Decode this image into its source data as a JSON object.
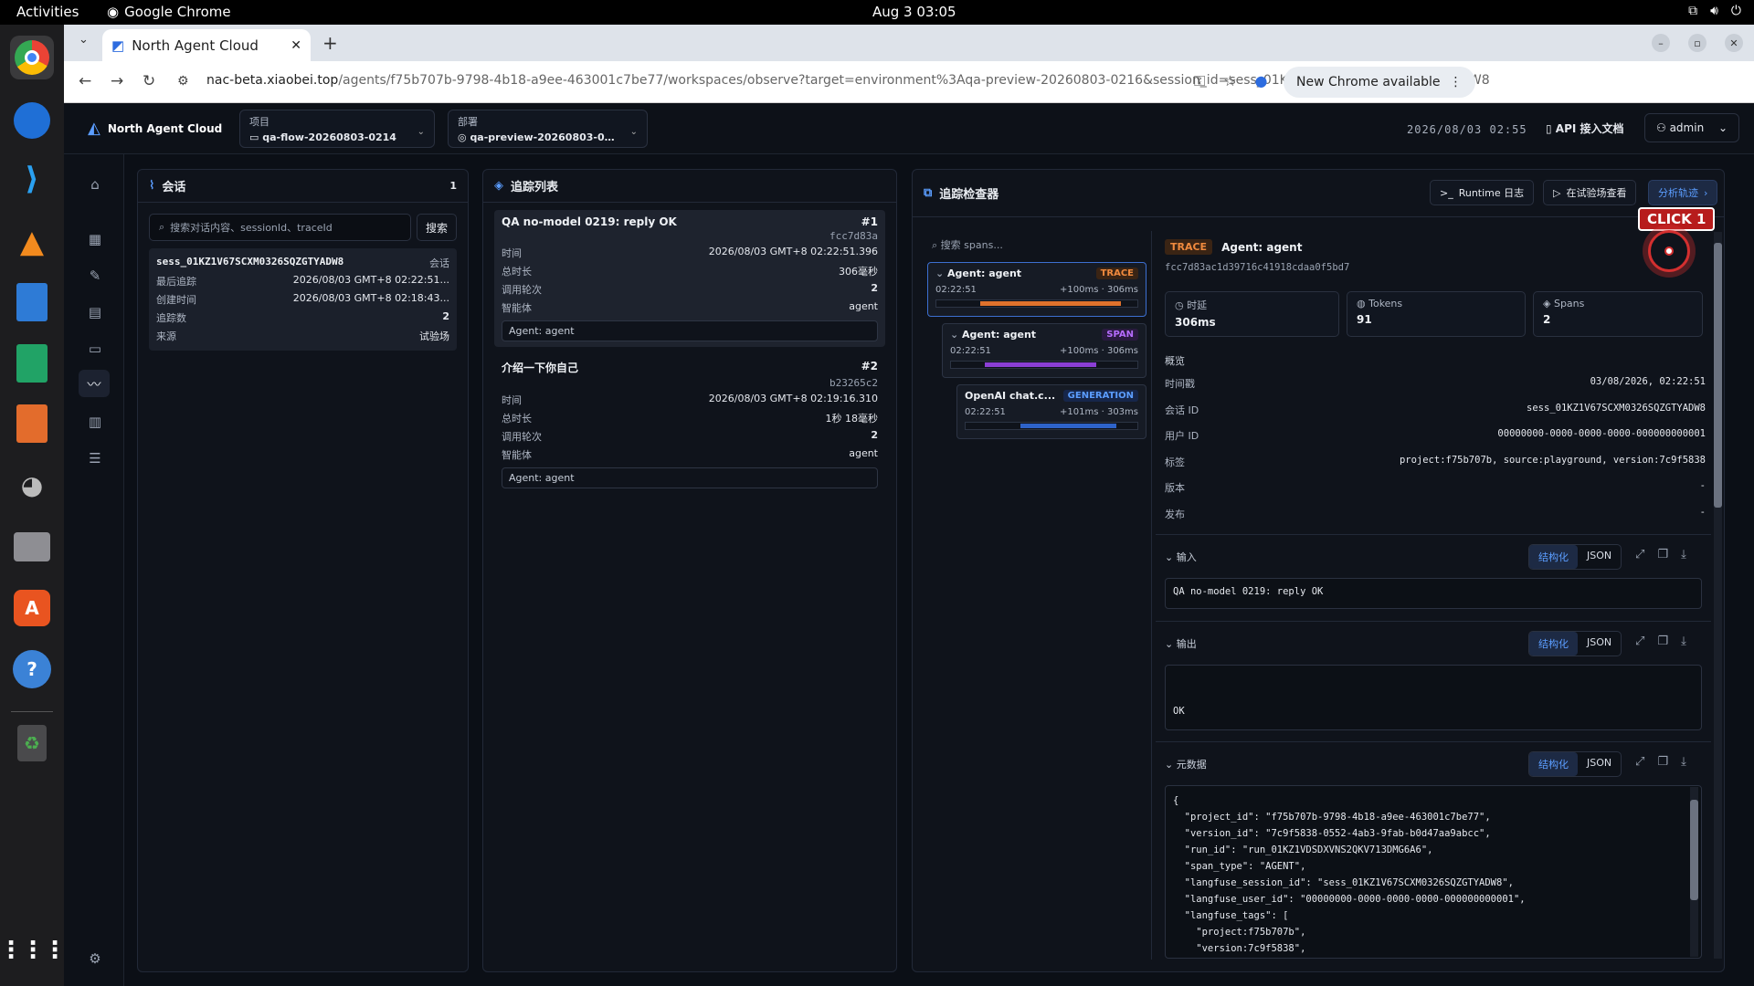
{
  "gnome": {
    "activities": "Activities",
    "app": "Google Chrome",
    "clock": "Aug 3  03:05"
  },
  "chrome": {
    "tab_title": "North Agent Cloud",
    "url_host": "nac-beta.xiaobei.top",
    "url_path": "/agents/f75b707b-9798-4b18-a9ee-463001c7be77/workspaces/observe?target=environment%3Aqa-preview-20260803-0216&session_id=sess_01KZ1V67SCXM0326SQZGTYADW8",
    "update_label": "New Chrome available"
  },
  "header": {
    "brand": "North Agent Cloud",
    "project_label": "项目",
    "project_value": "qa-flow-20260803-0214",
    "deploy_label": "部署",
    "deploy_value": "qa-preview-20260803-0…",
    "timestamp": "2026/08/03 02:55",
    "api_doc": "API 接入文档",
    "user": "admin"
  },
  "sessions": {
    "title": "会话",
    "count": "1",
    "search_placeholder": "搜索对话内容、sessionId、traceId",
    "search_btn": "搜索",
    "item": {
      "id": "sess_01KZ1V67SCXM0326SQZGTYADW8",
      "tag": "会话",
      "rows": [
        {
          "k": "最后追踪",
          "v": "2026/08/03 GMT+8 02:22:51..."
        },
        {
          "k": "创建时间",
          "v": "2026/08/03 GMT+8 02:18:43..."
        },
        {
          "k": "追踪数",
          "v": "2"
        },
        {
          "k": "来源",
          "v": "试验场"
        }
      ]
    }
  },
  "traces": {
    "title": "追踪列表",
    "items": [
      {
        "title": "QA no-model 0219: reply OK",
        "num": "#1",
        "hash": "fcc7d83a",
        "rows": [
          {
            "k": "时间",
            "v": "2026/08/03 GMT+8 02:22:51.396"
          },
          {
            "k": "总时长",
            "v": "306毫秒"
          },
          {
            "k": "调用轮次",
            "v": "2"
          },
          {
            "k": "智能体",
            "v": "agent"
          }
        ],
        "chip": "Agent: agent"
      },
      {
        "title": "介绍一下你自己",
        "num": "#2",
        "hash": "b23265c2",
        "rows": [
          {
            "k": "时间",
            "v": "2026/08/03 GMT+8 02:19:16.310"
          },
          {
            "k": "总时长",
            "v": "1秒 18毫秒"
          },
          {
            "k": "调用轮次",
            "v": "2"
          },
          {
            "k": "智能体",
            "v": "agent"
          }
        ],
        "chip": "Agent: agent"
      }
    ]
  },
  "inspector": {
    "title": "追踪检查器",
    "btn_runtime": "Runtime 日志",
    "btn_playground": "在试验场查看",
    "btn_analyze": "分析轨迹",
    "click_label": "CLICK 1",
    "search_spans": "搜索 spans...",
    "spans": [
      {
        "name": "Agent: agent",
        "type": "TRACE",
        "time": "02:22:51",
        "range": "+100ms · 306ms",
        "color": "#e0722c"
      },
      {
        "name": "Agent: agent",
        "type": "SPAN",
        "time": "02:22:51",
        "range": "+100ms · 306ms",
        "color": "#8b3fd6"
      },
      {
        "name": "OpenAI chat.c...",
        "type": "GENERATION",
        "time": "02:22:51",
        "range": "+101ms · 303ms",
        "color": "#2e63c9"
      }
    ],
    "detail": {
      "badge": "TRACE",
      "name": "Agent: agent",
      "id": "fcc7d83ac1d39716c41918cdaa0f5bd7",
      "stats": [
        {
          "k": "时延",
          "v": "306ms"
        },
        {
          "k": "Tokens",
          "v": "91"
        },
        {
          "k": "Spans",
          "v": "2"
        }
      ],
      "overview": "概览",
      "rows": [
        {
          "k": "时间戳",
          "v": "03/08/2026, 02:22:51"
        },
        {
          "k": "会话 ID",
          "v": "sess_01KZ1V67SCXM0326SQZGTYADW8"
        },
        {
          "k": "用户 ID",
          "v": "00000000-0000-0000-0000-000000000001"
        },
        {
          "k": "标签",
          "v": "project:f75b707b, source:playground, version:7c9f5838"
        },
        {
          "k": "版本",
          "v": "-"
        },
        {
          "k": "发布",
          "v": "-"
        }
      ],
      "input_label": "输入",
      "input_value": "QA no-model 0219: reply OK",
      "output_label": "输出",
      "output_value": "OK",
      "meta_label": "元数据",
      "tog_struct": "结构化",
      "tog_json": "JSON",
      "meta_text": "{\n  \"project_id\": \"f75b707b-9798-4b18-a9ee-463001c7be77\",\n  \"version_id\": \"7c9f5838-0552-4ab3-9fab-b0d47aa9abcc\",\n  \"run_id\": \"run_01KZ1VDSDXVNS2QKV713DMG6A6\",\n  \"span_type\": \"AGENT\",\n  \"langfuse_session_id\": \"sess_01KZ1V67SCXM0326SQZGTYADW8\",\n  \"langfuse_user_id\": \"00000000-0000-0000-0000-000000000001\",\n  \"langfuse_tags\": [\n    \"project:f75b707b\",\n    \"version:7c9f5838\","
    }
  }
}
